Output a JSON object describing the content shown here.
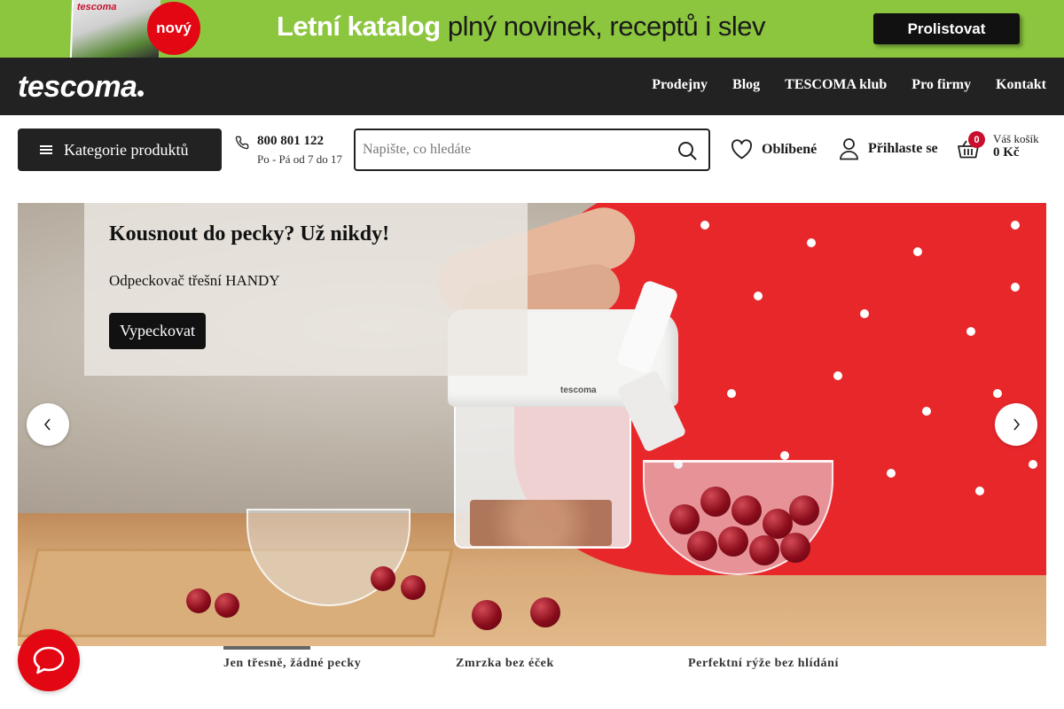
{
  "promo": {
    "catalog_brand": "tescoma",
    "badge": "nový",
    "headline_bold": "Letní katalog",
    "headline_rest": "plný novinek, receptů i slev",
    "button": "Prolistovat",
    "bg_color": "#8cc63f"
  },
  "header": {
    "logo": "tescoma",
    "nav": [
      "Prodejny",
      "Blog",
      "TESCOMA klub",
      "Pro firmy",
      "Kontakt"
    ]
  },
  "utility": {
    "categories_label": "Kategorie produktů",
    "phone_number": "800 801 122",
    "phone_hours": "Po - Pá od 7 do 17",
    "search_placeholder": "Napište, co hledáte",
    "favorites_label": "Oblíbené",
    "login_label": "Přihlaste se",
    "cart_count": "0",
    "cart_title": "Váš košík",
    "cart_total": "0 Kč"
  },
  "hero": {
    "title": "Kousnout do pecky? Už nikdy!",
    "subtitle": "Odpeckovač třešní HANDY",
    "cta": "Vypeckovat",
    "device_brand": "tescoma"
  },
  "slides": [
    "Jen třesně, žádné pecky",
    "Zmrzka bez éček",
    "Perfektní rýže bez hlídání"
  ],
  "colors": {
    "accent": "#e30613",
    "dark": "#222222"
  },
  "icons": {
    "phone": "phone-icon",
    "search": "search-icon",
    "favorites": "heart-icon",
    "login": "user-icon",
    "cart": "basket-icon",
    "chat": "chat-bubble-icon"
  }
}
